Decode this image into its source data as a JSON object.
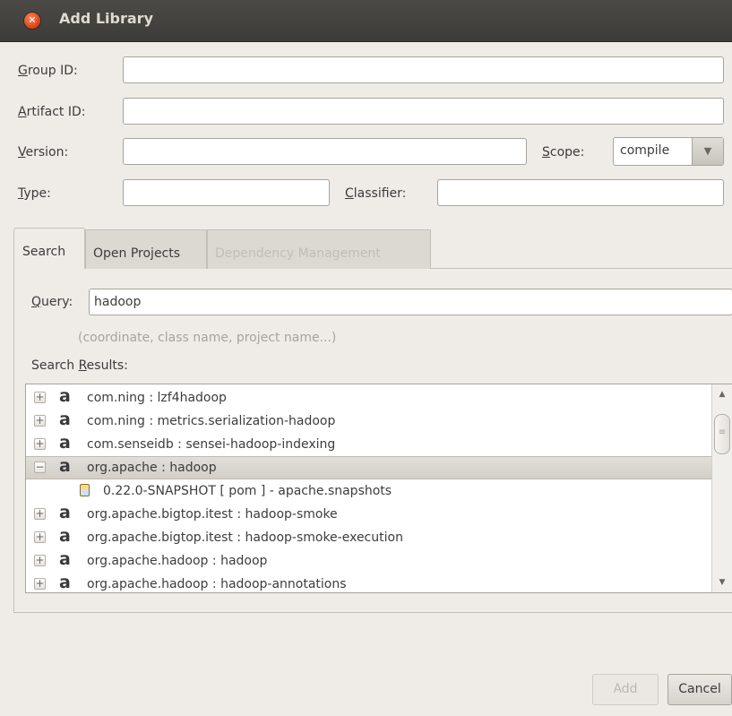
{
  "window": {
    "title": "Add Library"
  },
  "form": {
    "group_id": {
      "mnemonic": "G",
      "rest": "roup ID:",
      "value": ""
    },
    "artifact_id": {
      "mnemonic": "A",
      "rest": "rtifact ID:",
      "value": ""
    },
    "version": {
      "mnemonic": "V",
      "rest": "ersion:",
      "value": ""
    },
    "scope": {
      "mnemonic": "S",
      "rest": "cope:",
      "value": "compile"
    },
    "type": {
      "mnemonic": "T",
      "rest": "ype:",
      "value": ""
    },
    "classifier": {
      "mnemonic": "C",
      "rest": "lassifier:",
      "value": ""
    }
  },
  "tabs": [
    {
      "label": "Search",
      "active": true
    },
    {
      "label": "Open Projects",
      "active": false
    },
    {
      "label": "Dependency Management",
      "active": false,
      "disabled": true
    }
  ],
  "search": {
    "query_mnemonic": "Q",
    "query_rest": "uery:",
    "query_value": "hadoop",
    "hint": "(coordinate, class name, project name...)",
    "results_prefix": "Search ",
    "results_mnemonic": "R",
    "results_rest": "esults:"
  },
  "results": [
    {
      "expander": "+",
      "icon": "a",
      "text": "com.ning : lzf4hadoop"
    },
    {
      "expander": "+",
      "icon": "a",
      "text": "com.ning : metrics.serialization-hadoop"
    },
    {
      "expander": "+",
      "icon": "a",
      "text": "com.senseidb : sensei-hadoop-indexing"
    },
    {
      "expander": "−",
      "icon": "a",
      "text": "org.apache : hadoop",
      "selected": true
    },
    {
      "child": true,
      "icon": "jar-icon",
      "text": "0.22.0-SNAPSHOT [ pom ]  - apache.snapshots"
    },
    {
      "expander": "+",
      "icon": "a",
      "text": "org.apache.bigtop.itest : hadoop-smoke"
    },
    {
      "expander": "+",
      "icon": "a",
      "text": "org.apache.bigtop.itest : hadoop-smoke-execution"
    },
    {
      "expander": "+",
      "icon": "a",
      "text": "org.apache.hadoop : hadoop"
    },
    {
      "expander": "+",
      "icon": "a",
      "text": "org.apache.hadoop : hadoop-annotations"
    }
  ],
  "buttons": {
    "add": "Add",
    "cancel": "Cancel"
  },
  "colors": {
    "titlebar": "#3d3c38",
    "close": "#e1481d",
    "background": "#efebe7"
  }
}
